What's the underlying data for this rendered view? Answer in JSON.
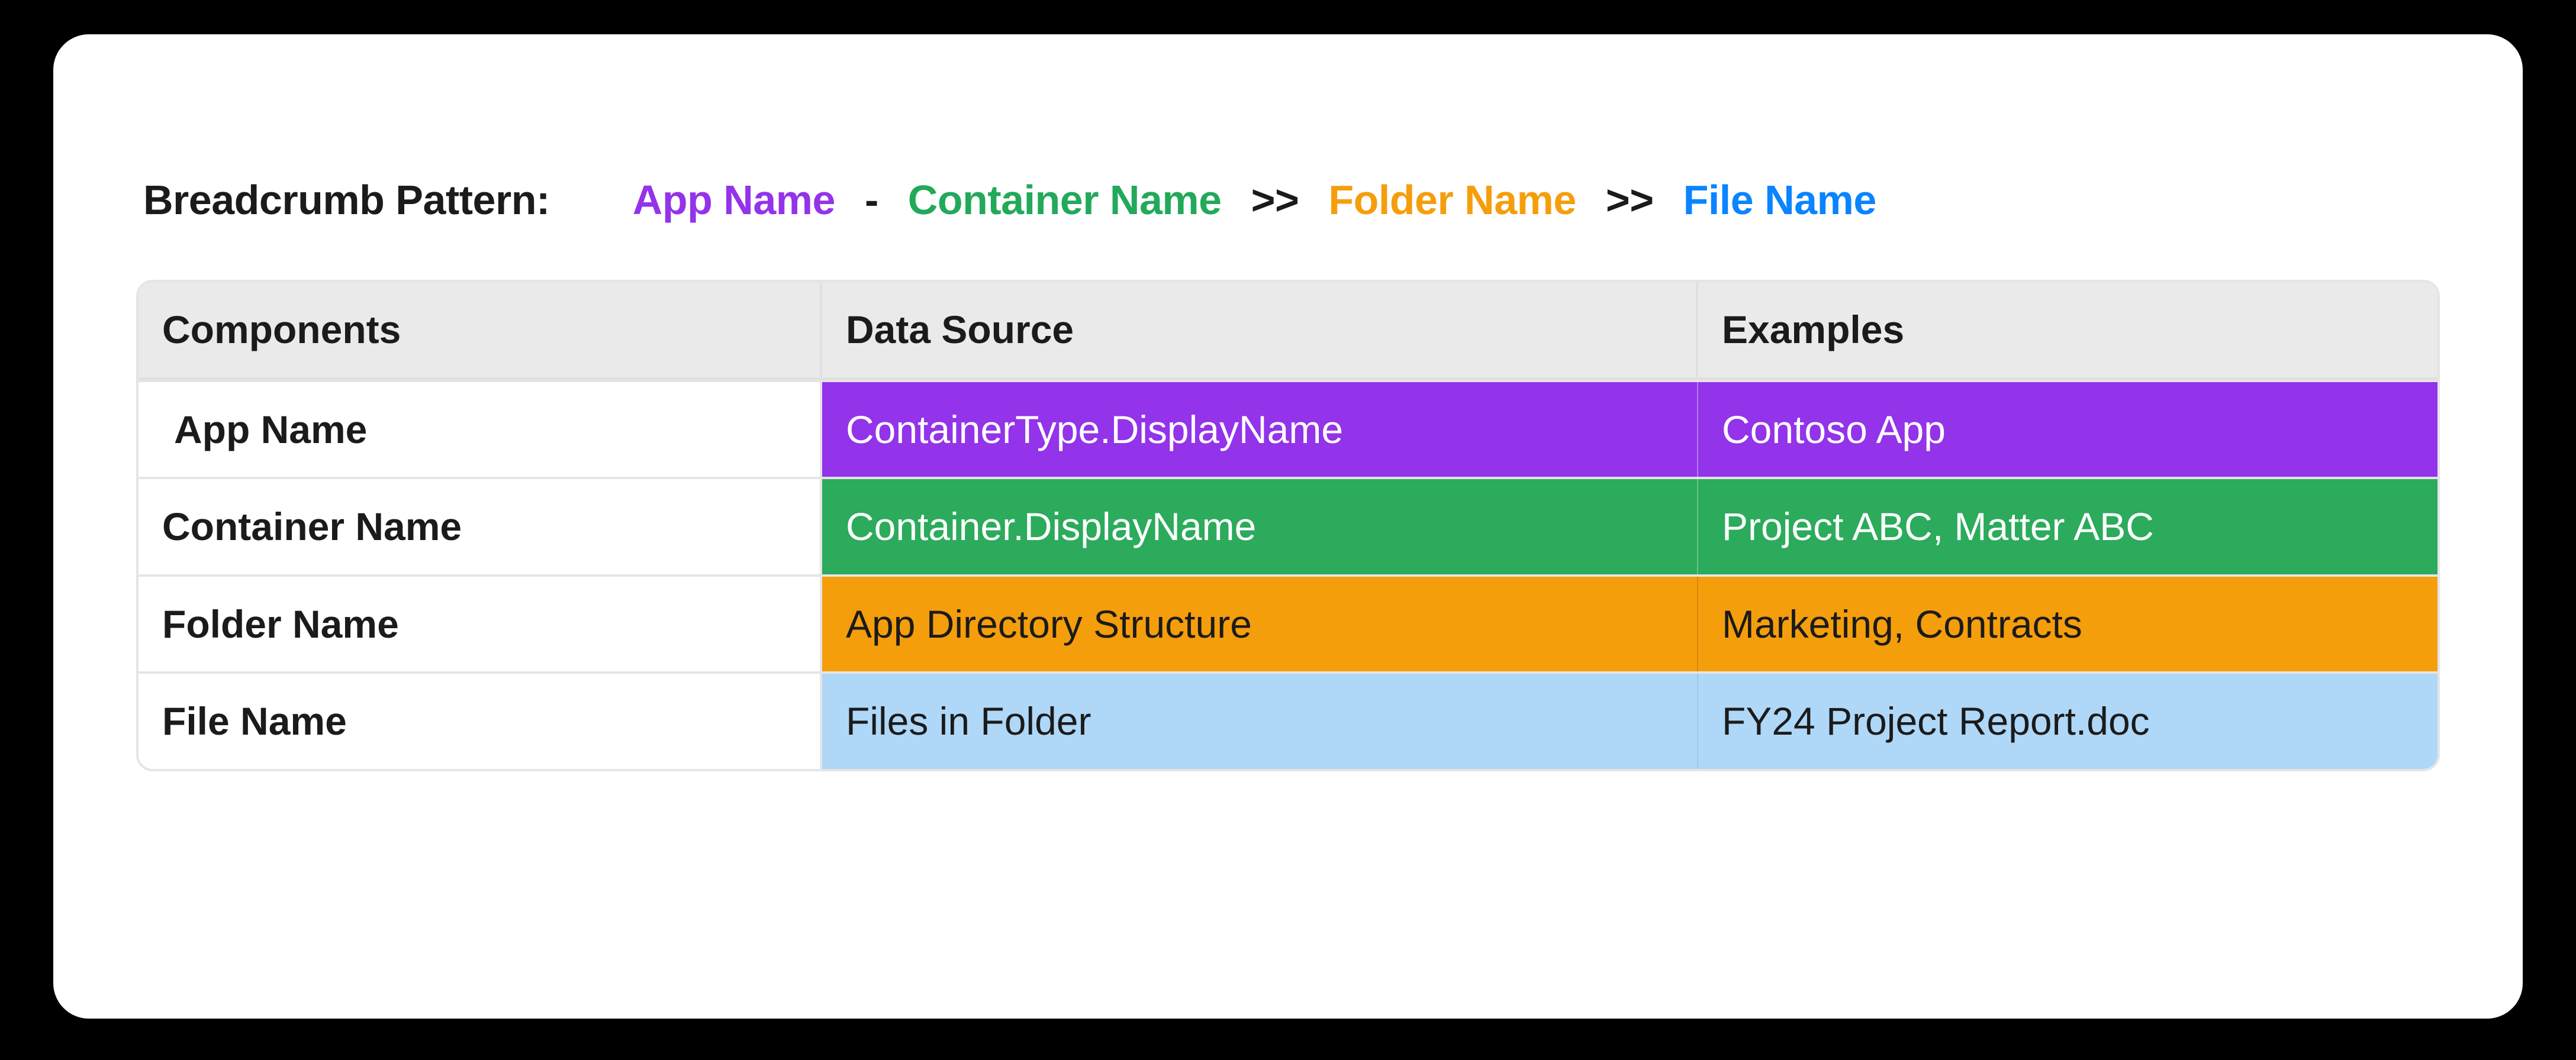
{
  "pattern": {
    "label": "Breadcrumb Pattern:",
    "app": "App Name",
    "sep1": "-",
    "container": "Container Name",
    "sep2": ">>",
    "folder": "Folder Name",
    "sep3": ">>",
    "file": "File Name"
  },
  "colors": {
    "app": "#9333EA",
    "container": "#22A95A",
    "folder": "#F59E0B",
    "file": "#0A84FF",
    "row_file_bg": "#AFD7F7"
  },
  "table": {
    "headers": {
      "components": "Components",
      "data_source": "Data Source",
      "examples": "Examples"
    },
    "rows": [
      {
        "component": "App Name",
        "data_source": "ContainerType.DisplayName",
        "example": "Contoso App"
      },
      {
        "component": "Container Name",
        "data_source": "Container.DisplayName",
        "example": "Project ABC, Matter ABC"
      },
      {
        "component": "Folder Name",
        "data_source": "App Directory Structure",
        "example": "Marketing, Contracts"
      },
      {
        "component": "File Name",
        "data_source": "Files in Folder",
        "example": "FY24 Project Report.doc"
      }
    ]
  }
}
